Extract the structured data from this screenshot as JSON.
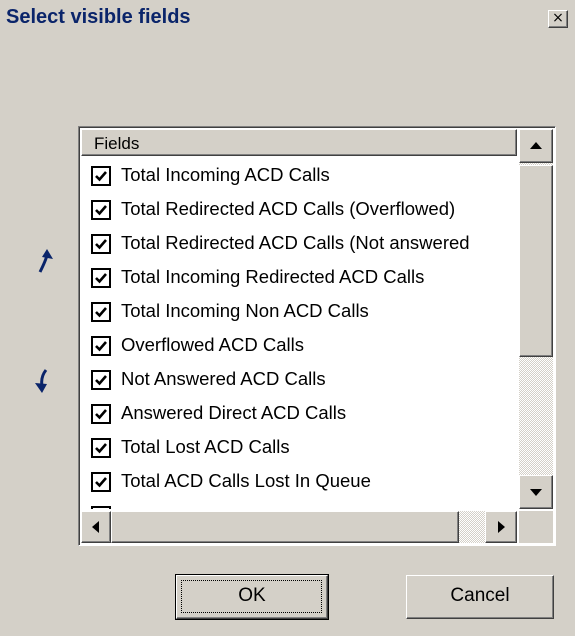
{
  "dialog": {
    "title": "Select visible fields",
    "close_symbol": "×"
  },
  "icons": {
    "move_up": "arrow-up-icon",
    "move_down": "arrow-down-icon",
    "checkmark": "checkmark-icon"
  },
  "list": {
    "header": "Fields",
    "items": [
      {
        "label": "Total Incoming ACD Calls",
        "checked": true
      },
      {
        "label": "Total Redirected ACD Calls (Overflowed)",
        "checked": true
      },
      {
        "label": "Total Redirected ACD Calls (Not answered",
        "checked": true
      },
      {
        "label": "Total Incoming Redirected ACD Calls",
        "checked": true
      },
      {
        "label": "Total Incoming Non ACD Calls",
        "checked": true
      },
      {
        "label": "Overflowed ACD Calls",
        "checked": true
      },
      {
        "label": "Not Answered ACD Calls",
        "checked": true
      },
      {
        "label": "Answered Direct ACD Calls",
        "checked": true
      },
      {
        "label": "Total Lost ACD Calls",
        "checked": true
      },
      {
        "label": "Total ACD Calls Lost In Queue",
        "checked": true
      }
    ]
  },
  "buttons": {
    "ok": "OK",
    "cancel": "Cancel"
  },
  "colors": {
    "title_text": "#0a246a",
    "face": "#d4d0c8",
    "arrow": "#0a246a"
  }
}
